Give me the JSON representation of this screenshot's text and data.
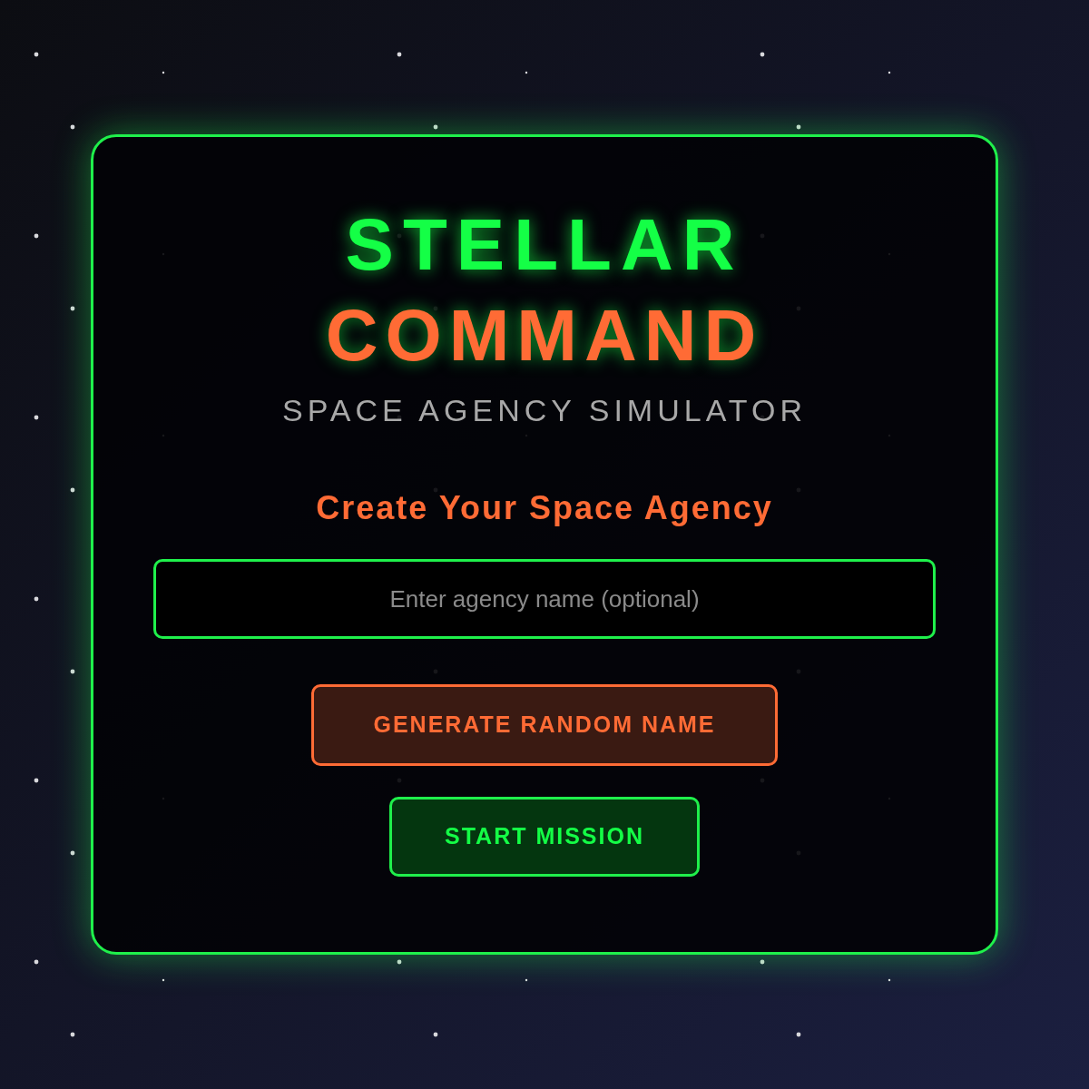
{
  "title": {
    "line_1": "STELLAR",
    "line_2": "COMMAND"
  },
  "subtitle": "SPACE AGENCY SIMULATOR",
  "form": {
    "heading": "Create Your Space Agency",
    "name_field": {
      "placeholder": "Enter agency name (optional)"
    },
    "buttons": [
      {
        "label": "GENERATE RANDOM NAME",
        "kind": "secondary"
      },
      {
        "label": "START MISSION",
        "kind": "primary"
      }
    ]
  }
}
